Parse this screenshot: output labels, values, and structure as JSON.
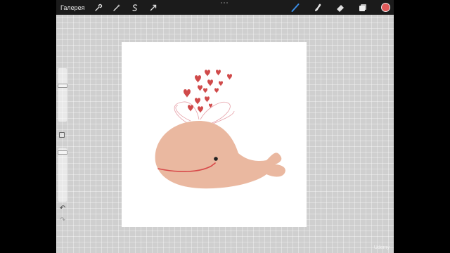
{
  "topbar": {
    "gallery_label": "Галерея",
    "tools_left": [
      {
        "icon": "wrench-icon"
      },
      {
        "icon": "magic-wand-icon"
      },
      {
        "icon": "selection-icon"
      },
      {
        "icon": "transform-arrow-icon"
      }
    ],
    "tools_right": [
      {
        "icon": "brush-icon"
      },
      {
        "icon": "smudge-icon"
      },
      {
        "icon": "eraser-icon"
      },
      {
        "icon": "layers-icon"
      }
    ],
    "current_color": "#e05a5a"
  },
  "sidebar": {
    "brush_size": 0.95,
    "opacity": 0.95
  },
  "colors": {
    "whale_body": "#eab8a0",
    "whale_mouth": "#d84a4a",
    "hearts": "#d04a4a",
    "water_outline": "#e6a0a8",
    "eye": "#222222"
  },
  "watermark": "Udemy"
}
